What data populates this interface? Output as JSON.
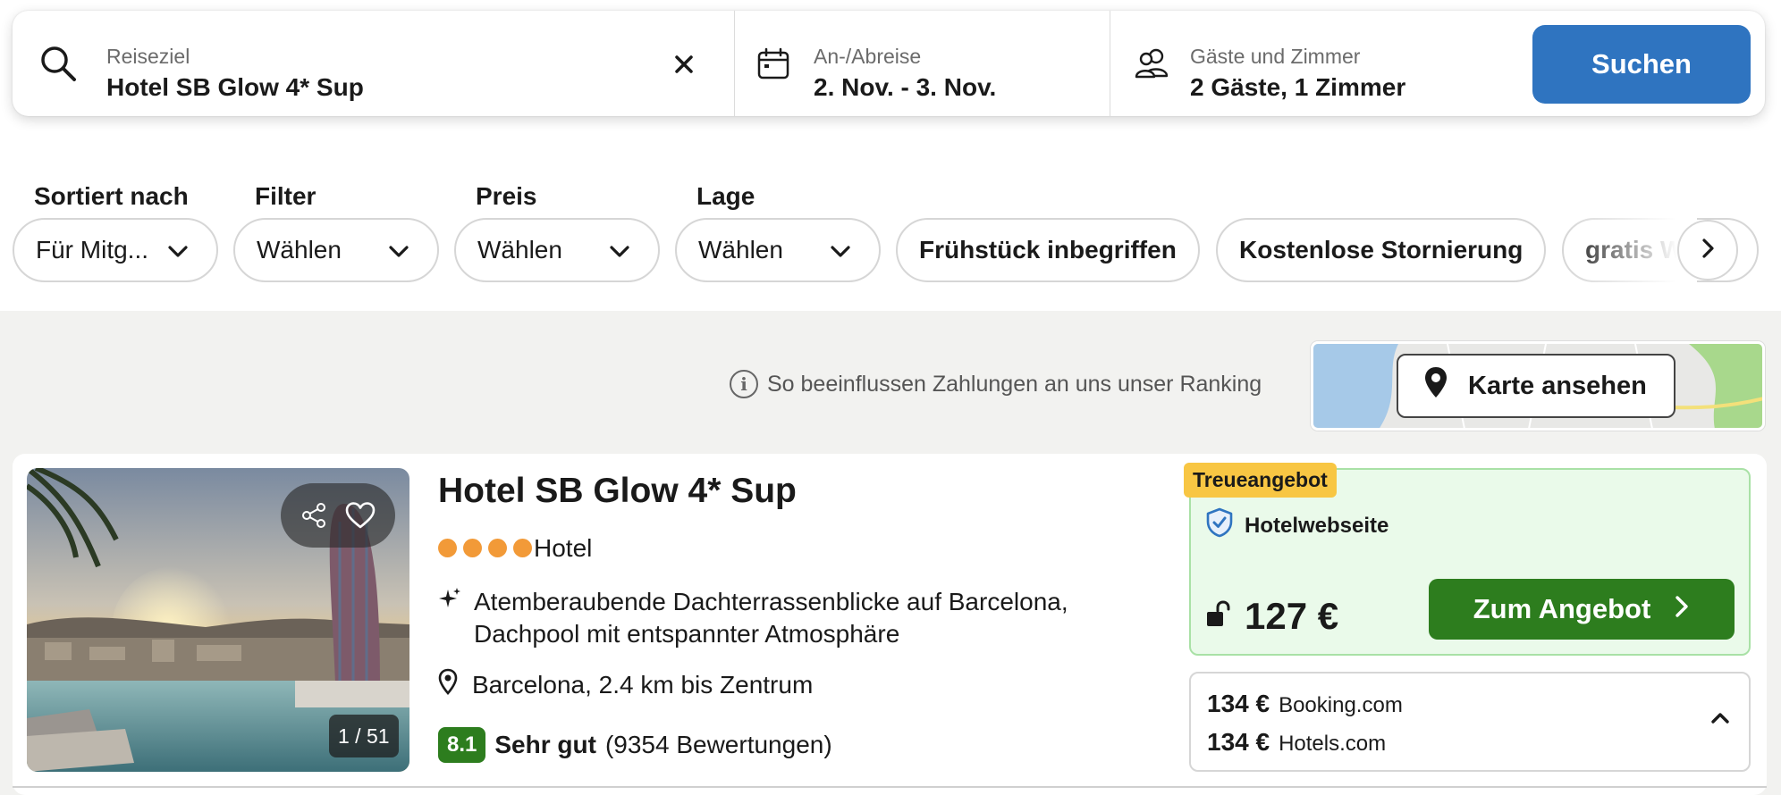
{
  "search": {
    "destination": {
      "label": "Reiseziel",
      "value": "Hotel SB Glow 4* Sup"
    },
    "dates": {
      "label": "An-/Abreise",
      "value": "2. Nov. - 3. Nov."
    },
    "guests": {
      "label": "Gäste und Zimmer",
      "value": "2 Gäste, 1 Zimmer"
    },
    "submit_label": "Suchen",
    "accent": "#2f74c0"
  },
  "filters": {
    "sort": {
      "label": "Sortiert nach",
      "value": "Für Mitg..."
    },
    "filter": {
      "label": "Filter",
      "value": "Wählen"
    },
    "price": {
      "label": "Preis",
      "value": "Wählen"
    },
    "location": {
      "label": "Lage",
      "value": "Wählen"
    },
    "chips": [
      "Frühstück inbegriffen",
      "Kostenlose Stornierung",
      "gratis WLAN"
    ]
  },
  "ranking_note": "So beeinflussen Zahlungen an uns unser Ranking",
  "map": {
    "button_label": "Karte ansehen"
  },
  "hotel": {
    "name": "Hotel SB Glow 4* Sup",
    "stars": 4,
    "type": "Hotel",
    "feature": "Atemberaubende Dachterrassenblicke auf Barcelona, Dachpool mit entspannter Atmosphäre",
    "location": "Barcelona, 2.4 km bis Zentrum",
    "rating": {
      "score": "8.1",
      "word": "Sehr gut",
      "reviews": "(9354 Bewertungen)"
    },
    "photo_counter": "1 / 51"
  },
  "offer": {
    "badge": "Treueangebot",
    "provider": "Hotelwebseite",
    "price": "127 €",
    "button_label": "Zum Angebot",
    "accent": "#2d7d1e"
  },
  "alt_prices": [
    {
      "amount": "134 €",
      "source": "Booking.com"
    },
    {
      "amount": "134 €",
      "source": "Hotels.com"
    }
  ]
}
